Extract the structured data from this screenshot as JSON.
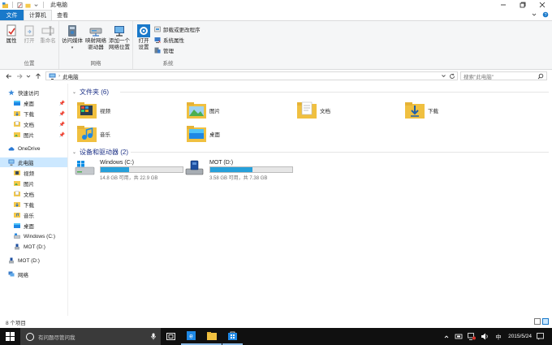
{
  "window": {
    "title": "此电脑"
  },
  "tabs": [
    {
      "label": "文件"
    },
    {
      "label": "计算机"
    },
    {
      "label": "查看"
    }
  ],
  "ribbon": {
    "location_group": {
      "label": "位置",
      "buttons": [
        {
          "label": "属性"
        },
        {
          "label": "打开"
        },
        {
          "label": "重命名"
        }
      ]
    },
    "network_group": {
      "label": "网络",
      "buttons": [
        {
          "label": "访问媒体"
        },
        {
          "label_line1": "映射网络",
          "label_line2": "驱动器"
        },
        {
          "label_line1": "添加一个",
          "label_line2": "网络位置"
        }
      ]
    },
    "system_group": {
      "label": "系统",
      "open_settings": {
        "label_line1": "打开",
        "label_line2": "设置"
      },
      "items": [
        {
          "label": "卸载或更改程序"
        },
        {
          "label": "系统属性"
        },
        {
          "label": "管理"
        }
      ]
    }
  },
  "address": {
    "path": "此电脑",
    "search_placeholder": "搜索\"此电脑\""
  },
  "sidebar": {
    "quick_access": "快速访问",
    "quick_items": [
      {
        "label": "桌面"
      },
      {
        "label": "下载"
      },
      {
        "label": "文档"
      },
      {
        "label": "图片"
      }
    ],
    "onedrive": "OneDrive",
    "this_pc": "此电脑",
    "pc_items": [
      {
        "label": "视频"
      },
      {
        "label": "图片"
      },
      {
        "label": "文档"
      },
      {
        "label": "下载"
      },
      {
        "label": "音乐"
      },
      {
        "label": "桌面"
      },
      {
        "label": "Windows (C:)"
      },
      {
        "label": "MOT (D:)"
      }
    ],
    "mot_drive": "MOT (D:)",
    "network": "网络"
  },
  "content": {
    "folders_header": "文件夹 (6)",
    "folders": [
      {
        "name": "视频"
      },
      {
        "name": "图片"
      },
      {
        "name": "文档"
      },
      {
        "name": "下载"
      },
      {
        "name": "音乐"
      },
      {
        "name": "桌面"
      }
    ],
    "drives_header": "设备和驱动器 (2)",
    "drives": [
      {
        "name": "Windows (C:)",
        "info": "14.8 GB 可用，共 22.9 GB",
        "used_fraction": 0.35
      },
      {
        "name": "MOT (D:)",
        "info": "3.58 GB 可用，共 7.38 GB",
        "used_fraction": 0.51
      }
    ]
  },
  "status": {
    "item_count": "8 个项目"
  },
  "taskbar": {
    "search_placeholder": "有问题尽管问我",
    "date": "2015/5/24"
  },
  "colors": {
    "accent": "#1979ca",
    "drive_bar": "#26a0da",
    "selection": "#cce8ff"
  }
}
